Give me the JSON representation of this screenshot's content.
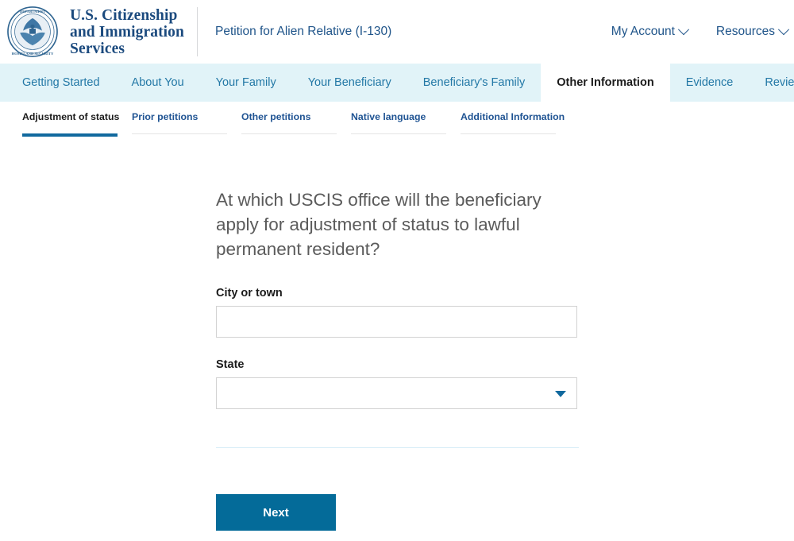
{
  "header": {
    "seal_icon": "dhs-seal-icon",
    "agency_line1": "U.S. Citizenship",
    "agency_line2": "and Immigration",
    "agency_line3": "Services",
    "form_title": "Petition for Alien Relative (I-130)",
    "my_account_label": "My Account",
    "resources_label": "Resources",
    "caret_icon": "chevron-down-icon"
  },
  "primary_nav": {
    "tabs": [
      {
        "label": "Getting Started",
        "active": false
      },
      {
        "label": "About You",
        "active": false
      },
      {
        "label": "Your Family",
        "active": false
      },
      {
        "label": "Your Beneficiary",
        "active": false
      },
      {
        "label": "Beneficiary's Family",
        "active": false
      },
      {
        "label": "Other Information",
        "active": true
      },
      {
        "label": "Evidence",
        "active": false
      },
      {
        "label": "Review and Submit",
        "active": false
      }
    ]
  },
  "sub_nav": {
    "items": [
      {
        "label": "Adjustment of status",
        "active": true
      },
      {
        "label": "Prior petitions",
        "active": false
      },
      {
        "label": "Other petitions",
        "active": false
      },
      {
        "label": "Native language",
        "active": false
      },
      {
        "label": "Additional Information",
        "active": false
      }
    ]
  },
  "main": {
    "question": "At which USCIS office will the beneficiary apply for adjustment of status to lawful permanent resident?",
    "city_label": "City or town",
    "city_value": "",
    "city_placeholder": "",
    "state_label": "State",
    "state_value": "",
    "state_caret_icon": "dropdown-caret-icon",
    "next_label": "Next"
  },
  "colors": {
    "nav_background": "#e1f3f8",
    "link_blue": "#20558a",
    "tab_blue": "#2378a6",
    "accent_blue": "#11699e",
    "button_blue": "#046b99",
    "heading_gray": "#5b5b5b",
    "input_border": "#d2d2d2",
    "divider": "#d9eef7"
  }
}
